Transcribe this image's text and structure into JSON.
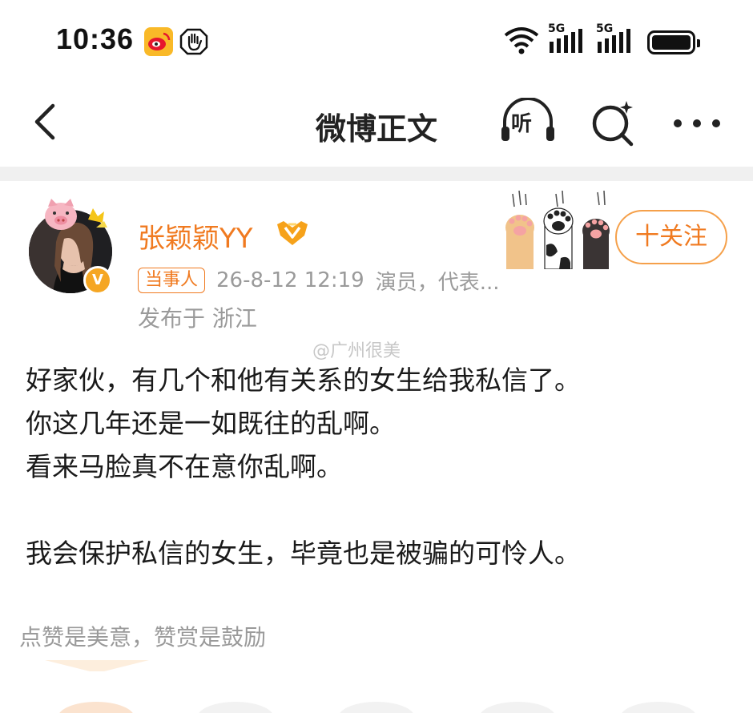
{
  "status_bar": {
    "time": "10:36",
    "network_1": "5G",
    "network_2": "5G"
  },
  "navbar": {
    "title": "微博正文",
    "listen_label": "听"
  },
  "post": {
    "author": "张颖颖YY",
    "role_tag": "当事人",
    "timestamp": "26-8-12 12:19",
    "description": "演员，代表...",
    "location": "发布于 浙江",
    "follow_label": "十关注",
    "watermark": "@广州很美",
    "verified_mark": "V",
    "content_lines": [
      "好家伙，有几个和他有关系的女生给我私信了。",
      "你这几年还是一如既往的乱啊。",
      "看来马脸真不在意你乱啊。",
      "",
      "我会保护私信的女生，毕竟也是被骗的可怜人。"
    ],
    "reward_text": "点赞是美意，赞赏是鼓励"
  },
  "colors": {
    "accent_orange": "#f07a20",
    "muted_gray": "#9a9a9a",
    "weibo_yellow": "#f9b928"
  },
  "icons": [
    "weibo-icon",
    "hand-icon",
    "wifi-icon",
    "signal-icon",
    "battery-icon",
    "back-icon",
    "listen-icon",
    "search-icon",
    "more-icon",
    "verified-icon",
    "vip-badge-icon",
    "pig-decoration-icon",
    "cat-paw-icon"
  ]
}
